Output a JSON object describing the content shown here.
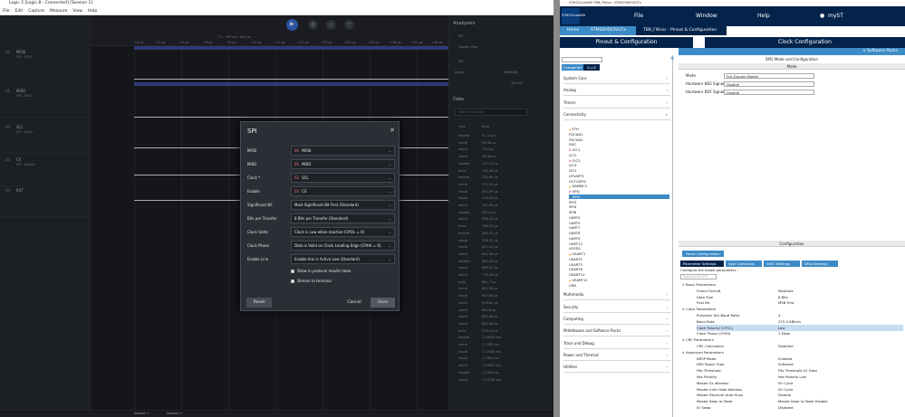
{
  "logic": {
    "title": "Logic 2 [Logic 8 - Connected] [Session 1]",
    "menu": [
      "File",
      "Edit",
      "Capture",
      "Measure",
      "View",
      "Help"
    ],
    "time_label": "7 s : 299 ms : 800 μs",
    "ruler_ticks": [
      "+0 μs",
      "+2 μs",
      "+4 μs",
      "+6 μs",
      "+8 μs",
      "+10 μs",
      "+11 μs",
      "+12 μs",
      "+13 μs",
      "+14 μs",
      "+15 μs",
      "+16 μs",
      "+17 μs",
      "+18 μs"
    ],
    "channels": [
      {
        "num": "00",
        "name": "MOSI",
        "sub": "SPI - MOSI"
      },
      {
        "num": "01",
        "name": "MISO",
        "sub": "SPI - MISO"
      },
      {
        "num": "02",
        "name": "SCL",
        "sub": "SPI - Clock"
      },
      {
        "num": "03",
        "name": "CS",
        "sub": "SPI - Enable"
      },
      {
        "num": "04",
        "name": "RST",
        "sub": ""
      }
    ],
    "analyzers": {
      "heading": "Analyzers",
      "spi": "SPI",
      "trigger": "Trigger View",
      "spi_field": "SPI",
      "query_label": "Query",
      "width_label": "Width(B)",
      "duration": "500 ms"
    },
    "data_panel": {
      "heading": "Data",
      "search_placeholder": "Search Protocols",
      "col_type": "Type",
      "col_start": "Start",
      "rows": [
        [
          "enable",
          "91.44 μs"
        ],
        [
          "result",
          "98.98 μs"
        ],
        [
          "result",
          "70.0 μs"
        ],
        [
          "result",
          "98.98 μs"
        ],
        [
          "disable",
          "113.74 μs"
        ],
        [
          "error",
          "130.08 μs"
        ],
        [
          "enable",
          "134.89 μs"
        ],
        [
          "result",
          "371.24 μs"
        ],
        [
          "result",
          "393.29 μs"
        ],
        [
          "result",
          "413.04 μs"
        ],
        [
          "result",
          "453.98 μs"
        ],
        [
          "disable",
          "583.4 μs"
        ],
        [
          "result",
          "598.32 μs"
        ],
        [
          "error",
          "588.32 μs"
        ],
        [
          "enable",
          "588.32 μs"
        ],
        [
          "result",
          "598.32 μs"
        ],
        [
          "result",
          "621.42 μs"
        ],
        [
          "result",
          "642.58 μs"
        ],
        [
          "disable",
          "650.43 μs"
        ],
        [
          "result",
          "688.87 μs"
        ],
        [
          "result",
          "778.28 μs"
        ],
        [
          "error",
          "881.7 μs"
        ],
        [
          "result",
          "861.89 μs"
        ],
        [
          "result",
          "910.63 μs"
        ],
        [
          "result",
          "918.82 μs"
        ],
        [
          "result",
          "881.8 μs"
        ],
        [
          "result",
          "892.08 μs"
        ],
        [
          "result",
          "880.08 μs"
        ],
        [
          "error",
          "919.04 μs"
        ],
        [
          "enable",
          "1.03055 ms"
        ],
        [
          "result",
          "1.1085 ms"
        ],
        [
          "result",
          "1.17806 ms"
        ],
        [
          "result",
          "1.1984 ms"
        ],
        [
          "result",
          "1.23005 ms"
        ],
        [
          "disable",
          "1.2456 ms"
        ],
        [
          "result",
          "1.25236 ms"
        ]
      ]
    },
    "status_tabs": [
      "Session 1",
      "Session 2"
    ]
  },
  "spi_dialog": {
    "title": "SPI",
    "fields": [
      {
        "label": "MOSI",
        "code": "00",
        "value": "MOSI"
      },
      {
        "label": "MISO",
        "code": "01",
        "value": "MISO"
      },
      {
        "label": "Clock *",
        "code": "02",
        "value": "SCL"
      },
      {
        "label": "Enable",
        "code": "03",
        "value": "CS"
      },
      {
        "label": "Significant Bit",
        "code": "",
        "value": "Most Significant Bit First (Standard)"
      },
      {
        "label": "Bits per Transfer",
        "code": "",
        "value": "8 Bits per Transfer (Standard)"
      },
      {
        "label": "Clock State",
        "code": "",
        "value": "Clock is Low when inactive (CPOL = 0)"
      },
      {
        "label": "Clock Phase",
        "code": "",
        "value": "Data is Valid on Clock Leading Edge (CPHA = 0)"
      },
      {
        "label": "Enable Line",
        "code": "",
        "value": "Enable line is Active Low (Standard)"
      }
    ],
    "check1": "Show in protocol results table",
    "check2": "Stream to terminal",
    "reset": "Reset",
    "cancel": "Cancel",
    "save": "Save"
  },
  "cube": {
    "title": "STM32CubeMX TBB_FW.ioc: STM32H563VGTx",
    "menu_file": "File",
    "menu_window": "Window",
    "menu_help": "Help",
    "menu_user": "myST",
    "logo": "STM32CubeMX",
    "crumbs": [
      "Home",
      "STM32H563VGTx",
      "TBB_FW.ioc - Pinout & Configuration"
    ],
    "tab_pinout": "Pinout & Configuration",
    "tab_clock": "Clock Configuration",
    "software_packs": "∨ Software Packs",
    "cat_tab1": "Categories",
    "cat_tab2": "A->Z",
    "categories_top": [
      "System Core",
      "Analog",
      "Timers",
      "Connectivity"
    ],
    "connectivity": [
      {
        "n": "ETH",
        "s": "warn"
      },
      {
        "n": "FDCAN1",
        "s": ""
      },
      {
        "n": "FDCAN2",
        "s": ""
      },
      {
        "n": "FMC",
        "s": ""
      },
      {
        "n": "I2C1",
        "s": "err"
      },
      {
        "n": "I2C2",
        "s": ""
      },
      {
        "n": "I2C3",
        "s": "err"
      },
      {
        "n": "I2C4",
        "s": ""
      },
      {
        "n": "I3C1",
        "s": ""
      },
      {
        "n": "LPUART1",
        "s": ""
      },
      {
        "n": "OCTOSPI1",
        "s": ""
      },
      {
        "n": "SDMMC1",
        "s": "warn"
      },
      {
        "n": "SPI1",
        "s": "err"
      },
      {
        "n": "SPI2",
        "s": "ok"
      },
      {
        "n": "SPI3",
        "s": ""
      },
      {
        "n": "SPI4",
        "s": ""
      },
      {
        "n": "SPI6",
        "s": ""
      },
      {
        "n": "UART4",
        "s": ""
      },
      {
        "n": "UART5",
        "s": ""
      },
      {
        "n": "UART7",
        "s": ""
      },
      {
        "n": "UART8",
        "s": ""
      },
      {
        "n": "UART9",
        "s": ""
      },
      {
        "n": "UART12",
        "s": ""
      },
      {
        "n": "UCPD1",
        "s": ""
      },
      {
        "n": "USART1",
        "s": "warn"
      },
      {
        "n": "USART2",
        "s": ""
      },
      {
        "n": "USART3",
        "s": ""
      },
      {
        "n": "USART6",
        "s": ""
      },
      {
        "n": "USART10",
        "s": ""
      },
      {
        "n": "USART11",
        "s": "warn"
      },
      {
        "n": "USB",
        "s": ""
      }
    ],
    "categories_bottom": [
      "Multimedia",
      "Security",
      "Computing",
      "Middleware and Software Packs",
      "Trace and Debug",
      "Power and Thermal",
      "Utilities"
    ],
    "mode_title": "SPI2 Mode and Configuration",
    "mode_header": "Mode",
    "mode_rows": [
      {
        "label": "Mode",
        "value": "Full-Duplex Master"
      },
      {
        "label": "Hardware NSS Signal",
        "value": "Disable"
      },
      {
        "label": "Hardware RDY Signal",
        "value": "Disable"
      }
    ],
    "config_header": "Configuration",
    "reset_config": "Reset Configuration",
    "param_tabs": [
      "Parameter Settings",
      "User Constants",
      "NVIC Settings",
      "DMA Settings"
    ],
    "configure_hint": "Configure the below parameters :",
    "search_placeholder": "Search (Ctrl+F)",
    "params": [
      {
        "n": "∨ Basic Parameters",
        "v": "",
        "g": true
      },
      {
        "n": "Frame Format",
        "v": "Motorola"
      },
      {
        "n": "Data Size",
        "v": "8 Bits"
      },
      {
        "n": "First Bit",
        "v": "MSB First"
      },
      {
        "n": "∨ Clock Parameters",
        "v": "",
        "g": true
      },
      {
        "n": "Prescaler (for Baud Rate)",
        "v": "4"
      },
      {
        "n": "Baud Rate",
        "v": "375.0 KBits/s"
      },
      {
        "n": "Clock Polarity (CPOL)",
        "v": "Low",
        "hl": true
      },
      {
        "n": "Clock Phase (CPHA)",
        "v": "1 Edge"
      },
      {
        "n": "∨ CRC Parameters",
        "v": "",
        "g": true
      },
      {
        "n": "CRC Calculation",
        "v": "Disabled"
      },
      {
        "n": "∨ Advanced Parameters",
        "v": "",
        "g": true
      },
      {
        "n": "NSSP Mode",
        "v": "Enabled"
      },
      {
        "n": "NSS Signal Type",
        "v": "Software"
      },
      {
        "n": "Fifo Threshold",
        "v": "Fifo Threshold 01 Data"
      },
      {
        "n": "Nss Polarity",
        "v": "Nss Polarity Low"
      },
      {
        "n": "Master Ss Idleness",
        "v": "00 Cycle"
      },
      {
        "n": "Master Inter Data Idleness",
        "v": "00 Cycle"
      },
      {
        "n": "Master Receiver Auto Susp",
        "v": "Disable"
      },
      {
        "n": "Master Keep Io State",
        "v": "Master Keep Io State Disable"
      },
      {
        "n": "IO Swap",
        "v": "Disabled"
      }
    ]
  },
  "colors": {
    "accent": "#3c8bc7",
    "navy": "#03234b",
    "spi_bar": "#3a4f9b"
  }
}
